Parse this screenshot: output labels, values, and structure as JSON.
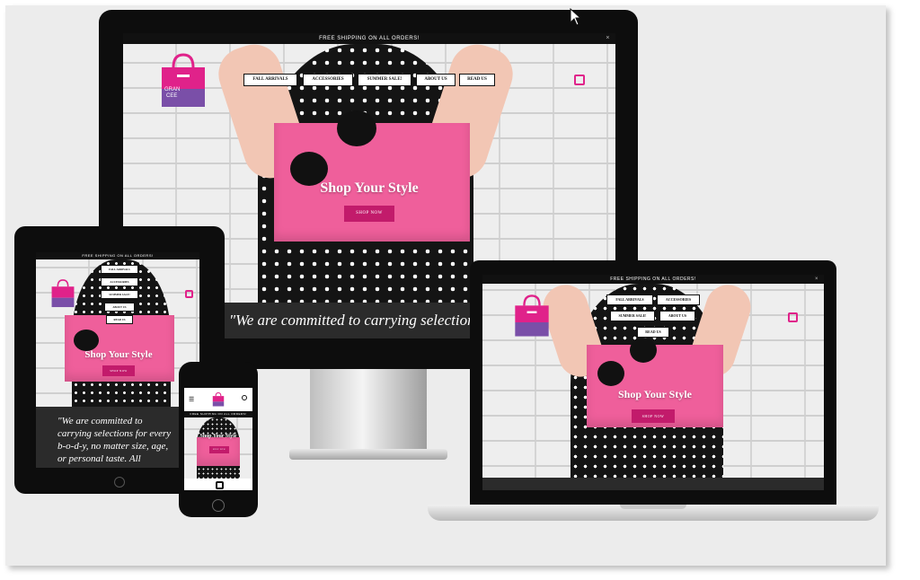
{
  "site": {
    "banner": "FREE SHIPPING ON ALL ORDERS!",
    "close": "×",
    "logo_line1": "GRAN",
    "logo_line2": "CEE",
    "nav": [
      "FALL ARRIVALS",
      "ACCESSORIES",
      "SUMMER SALE!",
      "ABOUT US",
      "READ US"
    ],
    "hero_title": "Shop Your Style",
    "cta": "SHOP NOW",
    "quote_desktop": "\"We are committed to carrying selection",
    "quote_tablet": [
      "\"We are committed to",
      "carrying selections for every",
      "b-o-d-y, no matter size, age,",
      "or personal taste. All"
    ]
  },
  "colors": {
    "brand_pink": "#e0228a",
    "clutch_pink": "#ef5f9b",
    "button_magenta": "#c21b6b",
    "logo_purple": "#7a4fa8"
  },
  "icons": [
    "cursor-icon",
    "cart-icon",
    "menu-icon",
    "search-icon",
    "close-icon",
    "handbag-logo-icon"
  ]
}
